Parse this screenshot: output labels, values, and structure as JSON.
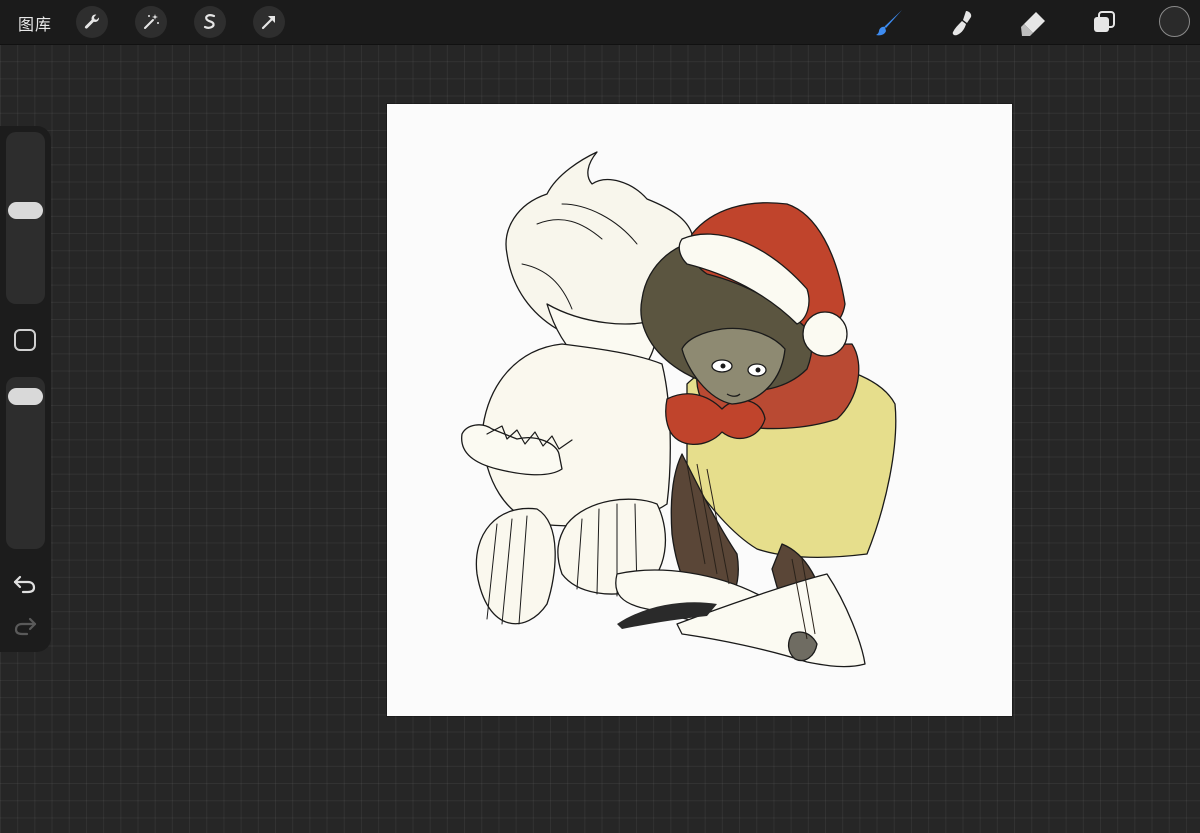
{
  "toolbar": {
    "gallery_label": "图库",
    "left_tools": [
      {
        "name": "wrench-icon",
        "label": "actions"
      },
      {
        "name": "magic-wand-icon",
        "label": "adjustments"
      },
      {
        "name": "selection-icon",
        "label": "selection"
      },
      {
        "name": "transform-arrow-icon",
        "label": "transform"
      }
    ],
    "right_tools": [
      {
        "name": "brush-icon",
        "active": true
      },
      {
        "name": "smudge-icon",
        "active": false
      },
      {
        "name": "eraser-icon",
        "active": false
      },
      {
        "name": "layers-icon",
        "active": false
      }
    ],
    "current_color": "#2a2a2a",
    "active_tool_color": "#3d8bf0"
  },
  "sidebar": {
    "brush_size_level": 0.55,
    "opacity_level": 0.95
  },
  "canvas": {
    "background": "#fbfbfb"
  }
}
